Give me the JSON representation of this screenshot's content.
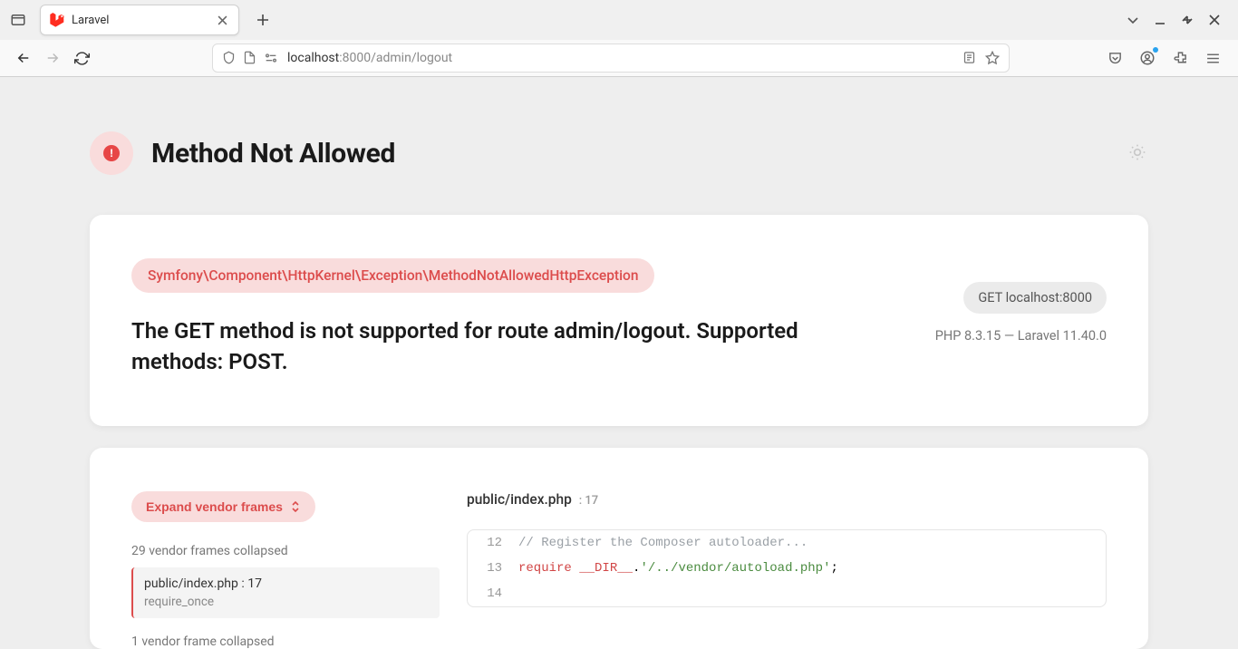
{
  "browser": {
    "tab_title": "Laravel",
    "url_host": "localhost",
    "url_port_path": ":8000/admin/logout"
  },
  "header": {
    "title": "Method Not Allowed"
  },
  "card": {
    "exception_class": "Symfony\\Component\\HttpKernel\\Exception\\MethodNotAllowedHttpException",
    "message": "The GET method is not supported for route admin/logout. Supported methods: POST.",
    "request": "GET localhost:8000",
    "meta": "PHP 8.3.15 — Laravel 11.40.0"
  },
  "frames": {
    "expand_label": "Expand vendor frames",
    "collapsed_top": "29 vendor frames collapsed",
    "active_frame_path": "public/index.php : 17",
    "active_frame_fn": "require_once",
    "collapsed_bottom": "1 vendor frame collapsed"
  },
  "code": {
    "header_path": "public/index.php",
    "header_line": ": 17",
    "lines": [
      {
        "n": "12",
        "type": "comment",
        "text": "// Register the Composer autoloader..."
      },
      {
        "n": "13",
        "type": "require",
        "kw": "require",
        "magic": "__DIR__",
        "rest": ".'/../vendor/autoload.php';"
      },
      {
        "n": "14",
        "type": "blank",
        "text": ""
      }
    ]
  }
}
